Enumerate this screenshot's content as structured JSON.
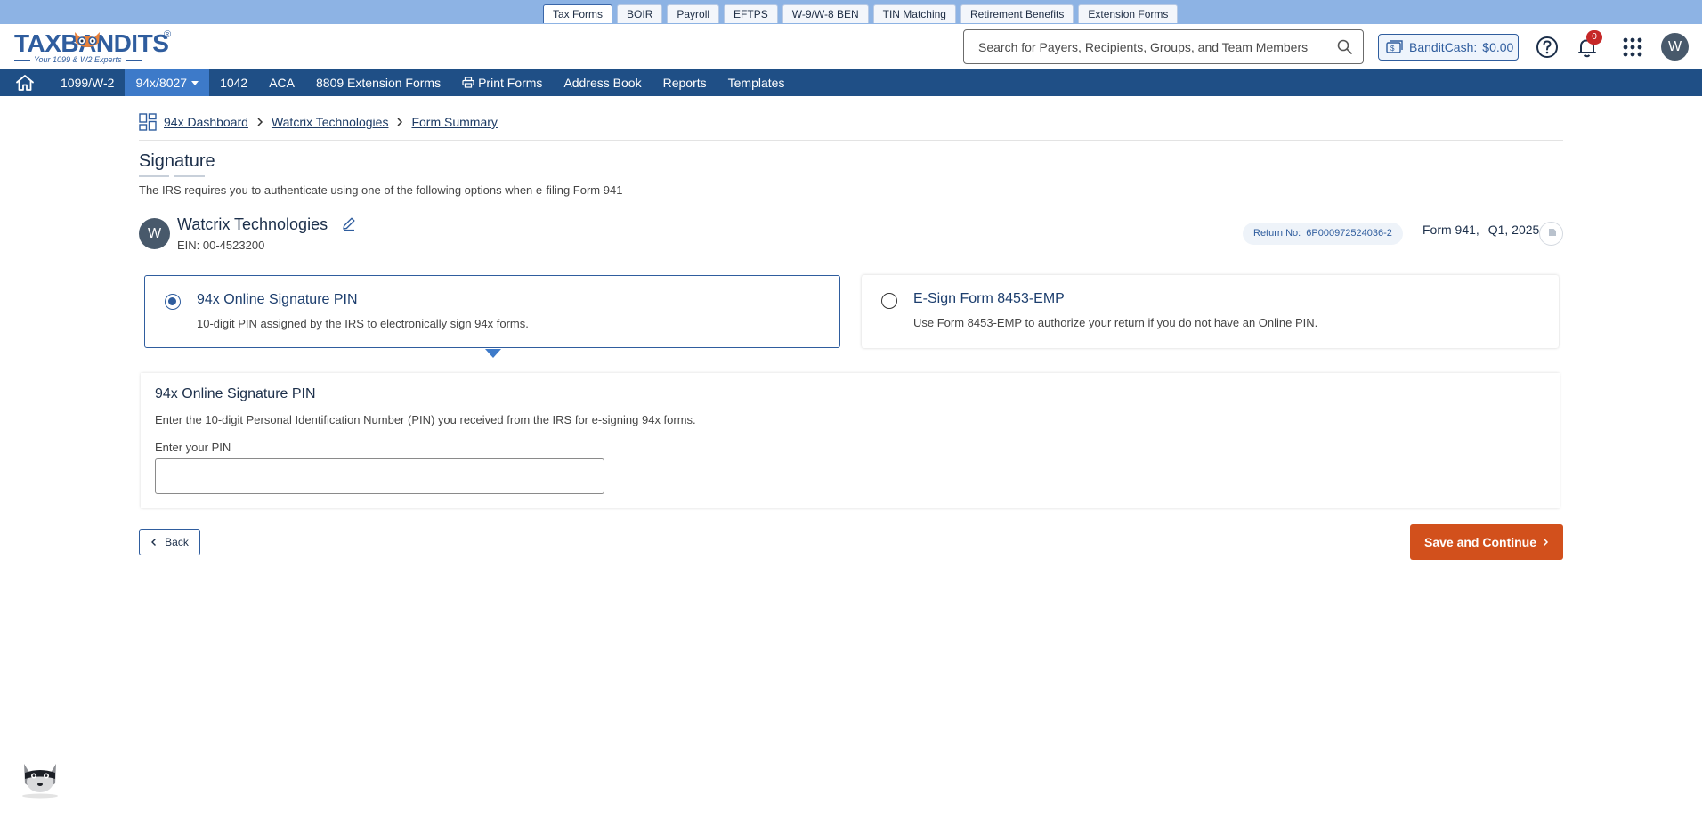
{
  "top_tabs": [
    "Tax Forms",
    "BOIR",
    "Payroll",
    "EFTPS",
    "W-9/W-8 BEN",
    "TIN Matching",
    "Retirement Benefits",
    "Extension Forms"
  ],
  "logo": {
    "wordmark": "TAXBANDITS",
    "registered": "®",
    "tagline": "Your 1099 & W2 Experts"
  },
  "search": {
    "placeholder": "Search for Payers, Recipients, Groups, and Team Members",
    "value": ""
  },
  "banditcash": {
    "label": "BanditCash:",
    "amount": "$0.00"
  },
  "notifications": {
    "count": "0"
  },
  "user": {
    "initial": "W"
  },
  "nav": {
    "items": [
      {
        "label": "1099/W-2"
      },
      {
        "label": "94x/8027"
      },
      {
        "label": "1042"
      },
      {
        "label": "ACA"
      },
      {
        "label": "8809 Extension Forms"
      },
      {
        "label": "Print Forms"
      },
      {
        "label": "Address Book"
      },
      {
        "label": "Reports"
      },
      {
        "label": "Templates"
      }
    ]
  },
  "breadcrumb": [
    "94x Dashboard",
    "Watcrix Technologies",
    "Form Summary"
  ],
  "page": {
    "title": "Signature",
    "subtitle": "The IRS requires you to authenticate using one of the following options when e-filing Form 941"
  },
  "payer": {
    "initial": "W",
    "name": "Watcrix Technologies",
    "ein": "EIN: 00-4523200",
    "return_label": "Return No:",
    "return_no": "6P000972524036-2",
    "form": "Form 941,",
    "quarter": "Q1, 2025"
  },
  "options": [
    {
      "title": "94x Online Signature PIN",
      "desc": "10-digit PIN assigned by the IRS to electronically sign 94x forms.",
      "selected": true
    },
    {
      "title": "E-Sign Form 8453-EMP",
      "desc": "Use Form 8453-EMP to authorize your return if you do not have an Online PIN.",
      "selected": false
    }
  ],
  "pin_section": {
    "title": "94x Online Signature PIN",
    "desc": "Enter the 10-digit Personal Identification Number (PIN) you received from the IRS for e-signing 94x forms.",
    "label": "Enter your PIN",
    "value": ""
  },
  "buttons": {
    "back": "Back",
    "save": "Save and Continue"
  },
  "colors": {
    "nav_bg": "#1f4f86",
    "nav_active": "#3d7ac9",
    "primary": "#2f5d9e",
    "save_bg": "#d2501c",
    "top_strip": "#8db3e4"
  },
  "icons": [
    "home-icon",
    "search-icon",
    "banditcash-icon",
    "help-icon",
    "bell-icon",
    "apps-grid-icon",
    "printer-icon",
    "dashboard-grid-icon",
    "chevron-right-icon",
    "edit-pencil-icon",
    "document-icon",
    "chevron-left-icon",
    "mascot-icon"
  ]
}
